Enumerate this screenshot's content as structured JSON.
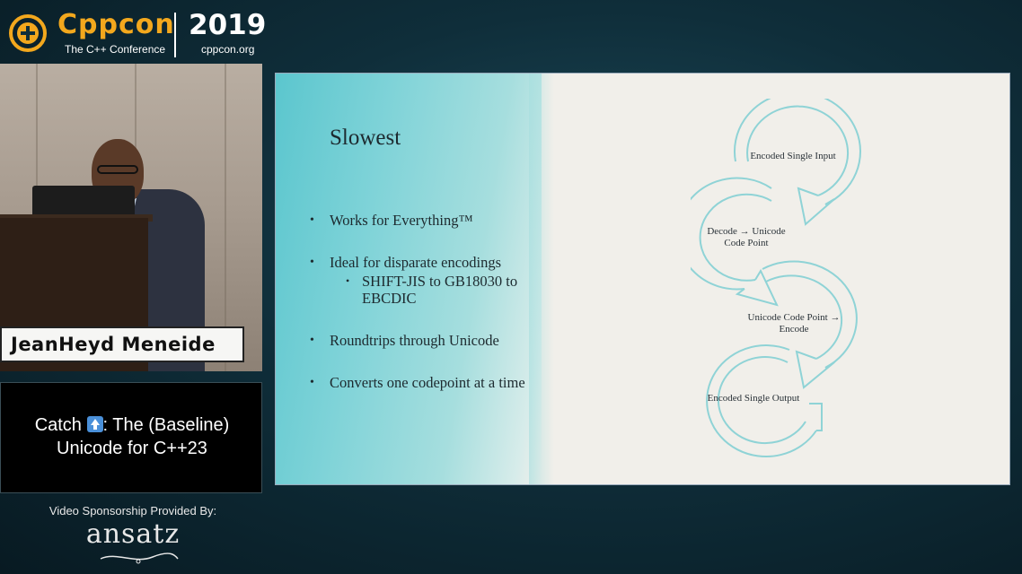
{
  "header": {
    "brand": "Cppcon",
    "tagline": "The C++ Conference",
    "year": "2019",
    "site": "cppcon.org"
  },
  "speaker": {
    "name": "JeanHeyd Meneide"
  },
  "talk": {
    "line1_prefix": "Catch ",
    "line1_suffix": ": The (Baseline)",
    "line2": "Unicode for C++23",
    "emoji": "up-arrow-emoji"
  },
  "sponsor": {
    "label": "Video Sponsorship Provided By:",
    "logo": "ansatz"
  },
  "slide": {
    "title": "Slowest",
    "bullets": [
      {
        "text": "Works for Everything™"
      },
      {
        "text": "Ideal for disparate encodings",
        "sub": "SHIFT-JIS to GB18030 to EBCDIC"
      },
      {
        "text": "Roundtrips through Unicode"
      },
      {
        "text": "Converts one codepoint at a time"
      }
    ],
    "cycle_steps": [
      "Encoded Single Input",
      "Decode → Unicode Code Point",
      "Unicode Code Point → Encode",
      "Encoded Single Output"
    ]
  },
  "colors": {
    "brand_orange": "#f3a81d",
    "slide_teal": "#5bc6ce",
    "arrow_stroke": "#8fd3d6"
  }
}
